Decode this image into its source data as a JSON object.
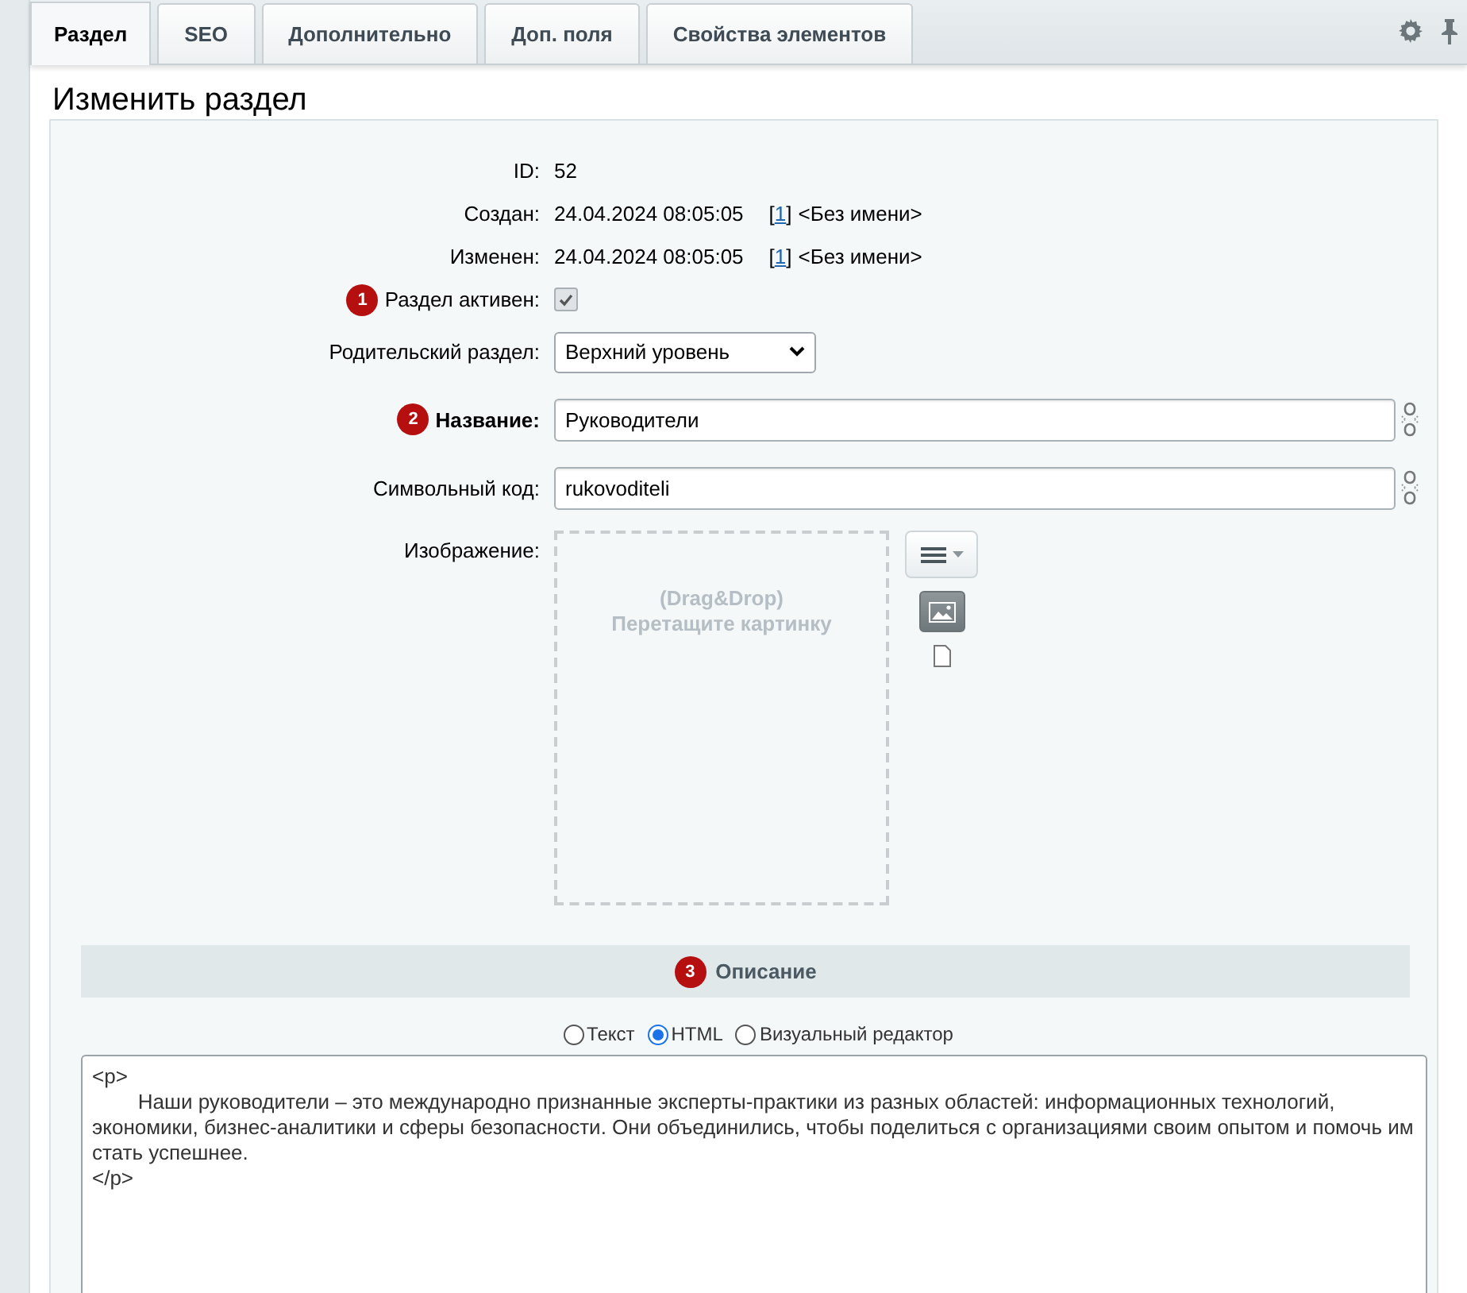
{
  "tabs": [
    {
      "label": "Раздел",
      "selected": true
    },
    {
      "label": "SEO",
      "selected": false
    },
    {
      "label": "Дополнительно",
      "selected": false
    },
    {
      "label": "Доп. поля",
      "selected": false
    },
    {
      "label": "Свойства элементов",
      "selected": false
    }
  ],
  "title": "Изменить раздел",
  "info_rows": [
    {
      "label": "ID:",
      "value": "52"
    },
    {
      "label": "Создан:",
      "value": "24.04.2024 08:05:05",
      "bracket_open": "[",
      "user_link": "1",
      "bracket_close": "]",
      "user_name": "<Без имени>"
    },
    {
      "label": "Изменен:",
      "value": "24.04.2024 08:05:05",
      "bracket_open": "[",
      "user_link": "1",
      "bracket_close": "]",
      "user_name": "<Без имени>"
    }
  ],
  "active": {
    "badge": "1",
    "label": "Раздел активен:",
    "checked": true
  },
  "parent": {
    "label": "Родительский раздел:",
    "value": "Верхний уровень"
  },
  "name": {
    "badge": "2",
    "label": "Название:",
    "value": "Руководители"
  },
  "code": {
    "label": "Символьный код:",
    "value": "rukovoditeli"
  },
  "image": {
    "label": "Изображение:",
    "hint_lines": [
      "(Drag&Drop)",
      "Перетащите картинку"
    ]
  },
  "description": {
    "badge": "3",
    "title": "Описание",
    "modes": [
      {
        "label": "Текст",
        "selected": false
      },
      {
        "label": "HTML",
        "selected": true
      },
      {
        "label": "Визуальный редактор",
        "selected": false
      }
    ],
    "lines": [
      "<p>",
      "\tНаши руководители – это международно признанные эксперты-практики из разных областей: информационных технологий, экономики, бизнес-аналитики и сферы безопасности. Они объединились, чтобы поделиться с организациями своим опытом и помочь им стать успешнее.",
      "</p>"
    ]
  }
}
